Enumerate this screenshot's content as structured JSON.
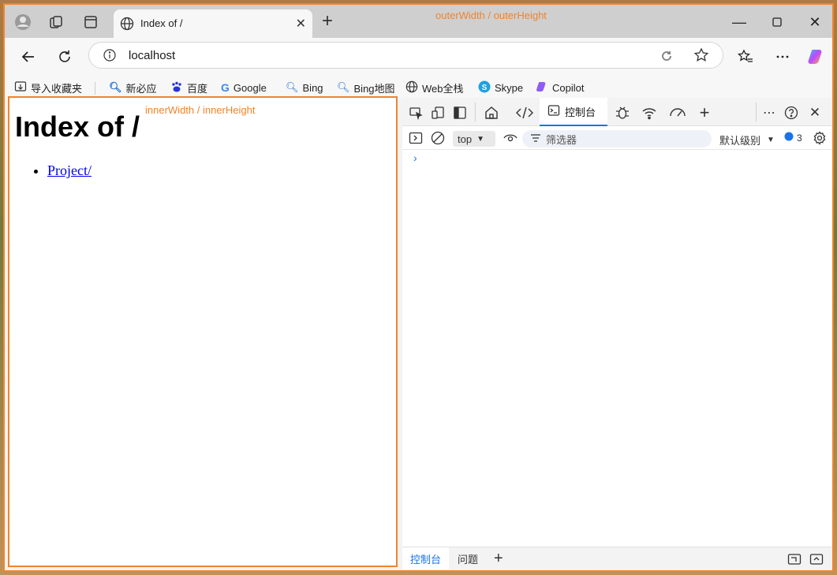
{
  "overlay": {
    "outer_label": "outerWidth / outerHeight",
    "inner_label": "innerWidth / innerHeight",
    "accent": "#f0842c"
  },
  "browser": {
    "tab": {
      "title": "Index of /",
      "icon": "globe-icon"
    },
    "address": {
      "url": "localhost"
    },
    "bookmarks": [
      {
        "label": "导入收藏夹",
        "icon": "import-icon"
      },
      {
        "label": "新必应",
        "icon": "search-icon"
      },
      {
        "label": "百度",
        "icon": "baidu-paw-icon"
      },
      {
        "label": "Google",
        "icon": "google-g-icon"
      },
      {
        "label": "Bing",
        "icon": "search-icon"
      },
      {
        "label": "Bing地图",
        "icon": "search-icon"
      },
      {
        "label": "Web全栈",
        "icon": "globe-icon"
      },
      {
        "label": "Skype",
        "icon": "skype-icon"
      },
      {
        "label": "Copilot",
        "icon": "copilot-icon"
      }
    ]
  },
  "page": {
    "heading": "Index of /",
    "links": [
      {
        "label": "Project/"
      }
    ]
  },
  "devtools": {
    "active_tab": "控制台",
    "context": "top",
    "filter_placeholder": "筛选器",
    "levels": "默认级别",
    "issues_count": "3",
    "drawer_tabs": [
      "控制台",
      "问题"
    ],
    "accent": "#1a73e8"
  }
}
